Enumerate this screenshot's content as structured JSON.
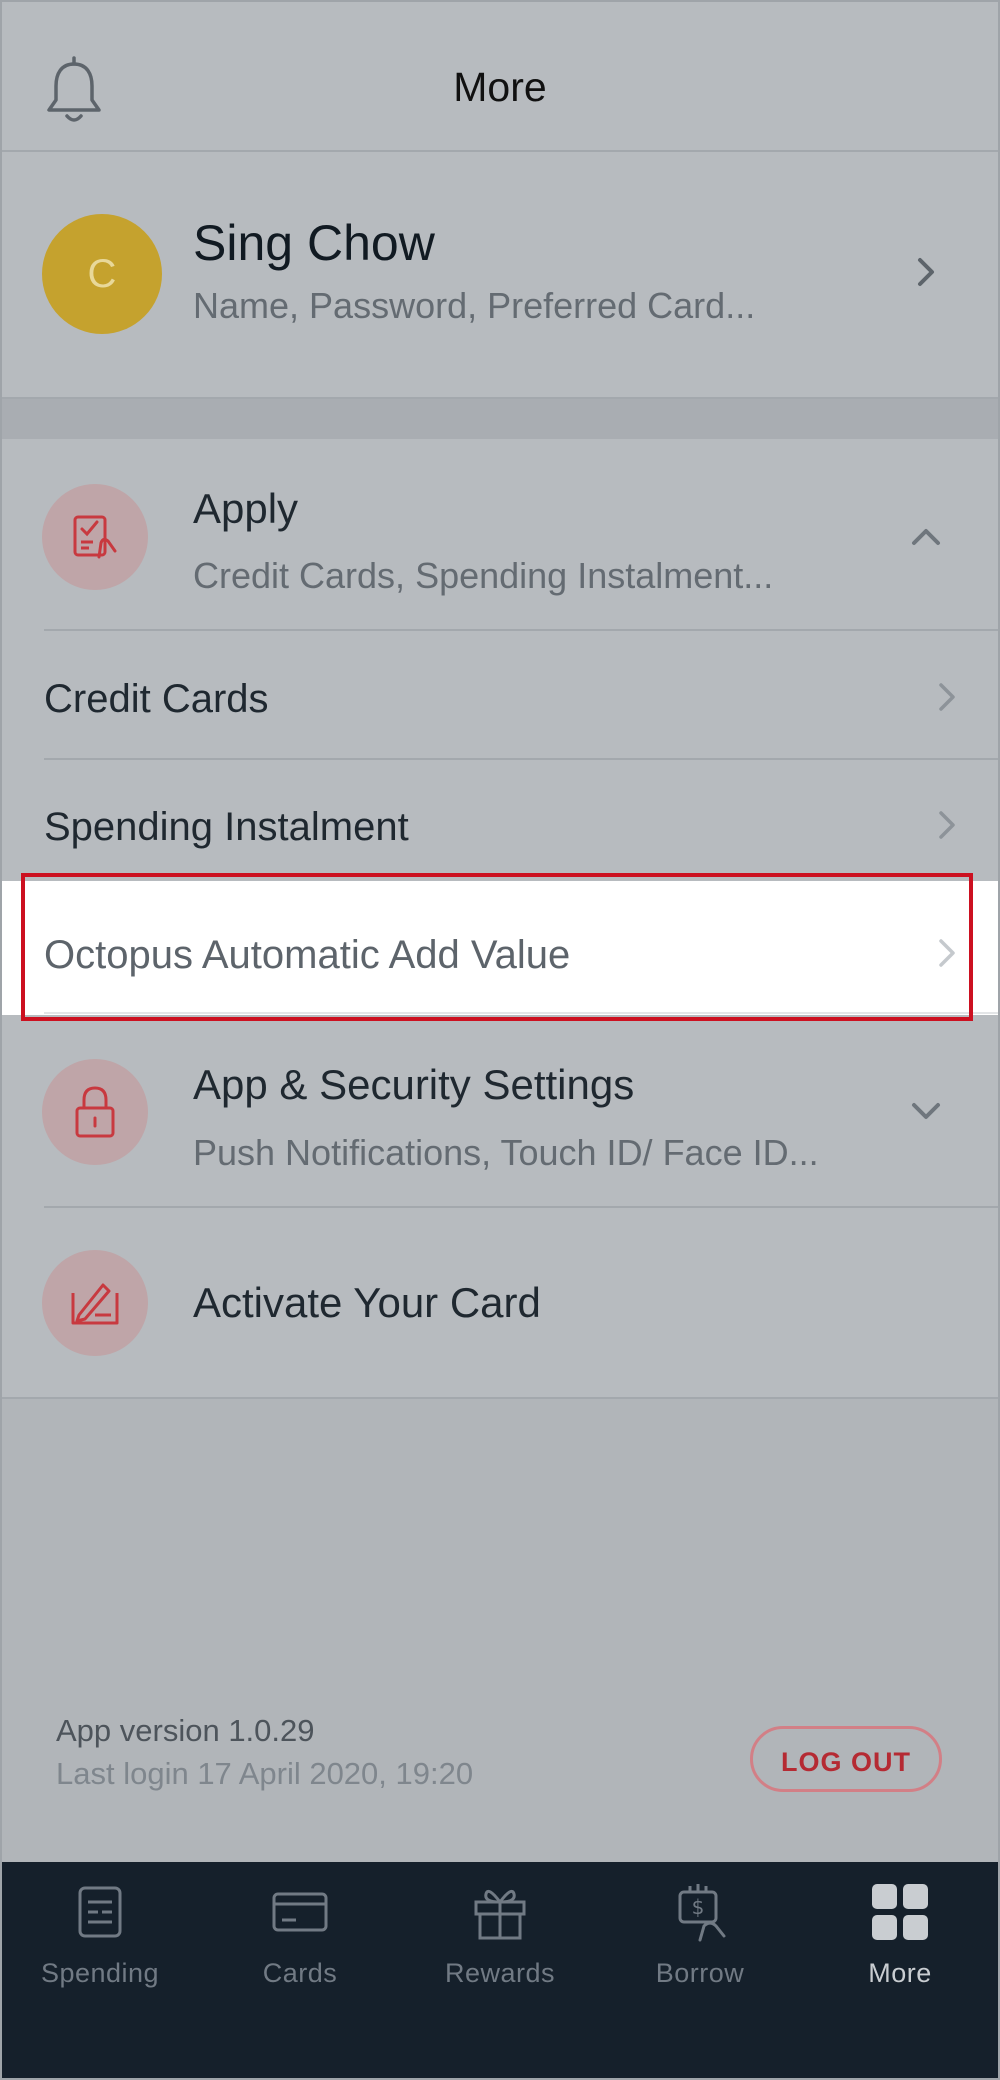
{
  "header": {
    "title": "More",
    "bell_icon": "bell-icon"
  },
  "profile": {
    "avatar_initial": "C",
    "avatar_color": "#c5a22e",
    "name": "Sing Chow",
    "subtitle": "Name, Password, Preferred Card..."
  },
  "menu": {
    "apply": {
      "title": "Apply",
      "subtitle": "Credit Cards, Spending Instalment...",
      "icon": "apply-form-icon",
      "expanded": true
    },
    "apply_items": [
      {
        "label": "Credit Cards"
      },
      {
        "label": "Spending Instalment"
      },
      {
        "label": "Octopus Automatic Add Value",
        "highlighted": true
      }
    ],
    "settings": {
      "title": "App & Security Settings",
      "subtitle": "Push Notifications, Touch ID/ Face ID...",
      "icon": "lock-icon",
      "expanded": false
    },
    "activate": {
      "title": "Activate Your Card",
      "icon": "card-sign-icon"
    }
  },
  "footer": {
    "version": "App version 1.0.29",
    "last_login": "Last login 17 April 2020, 19:20",
    "logout_label": "LOG OUT"
  },
  "tabs": [
    {
      "label": "Spending",
      "icon": "spending-icon"
    },
    {
      "label": "Cards",
      "icon": "card-icon"
    },
    {
      "label": "Rewards",
      "icon": "gift-icon"
    },
    {
      "label": "Borrow",
      "icon": "money-hand-icon"
    },
    {
      "label": "More",
      "icon": "grid-icon",
      "active": true
    }
  ],
  "colors": {
    "accent_red": "#cc1020",
    "tabbar_bg": "#15202b",
    "overlay_bg": "#b7bbbf"
  }
}
